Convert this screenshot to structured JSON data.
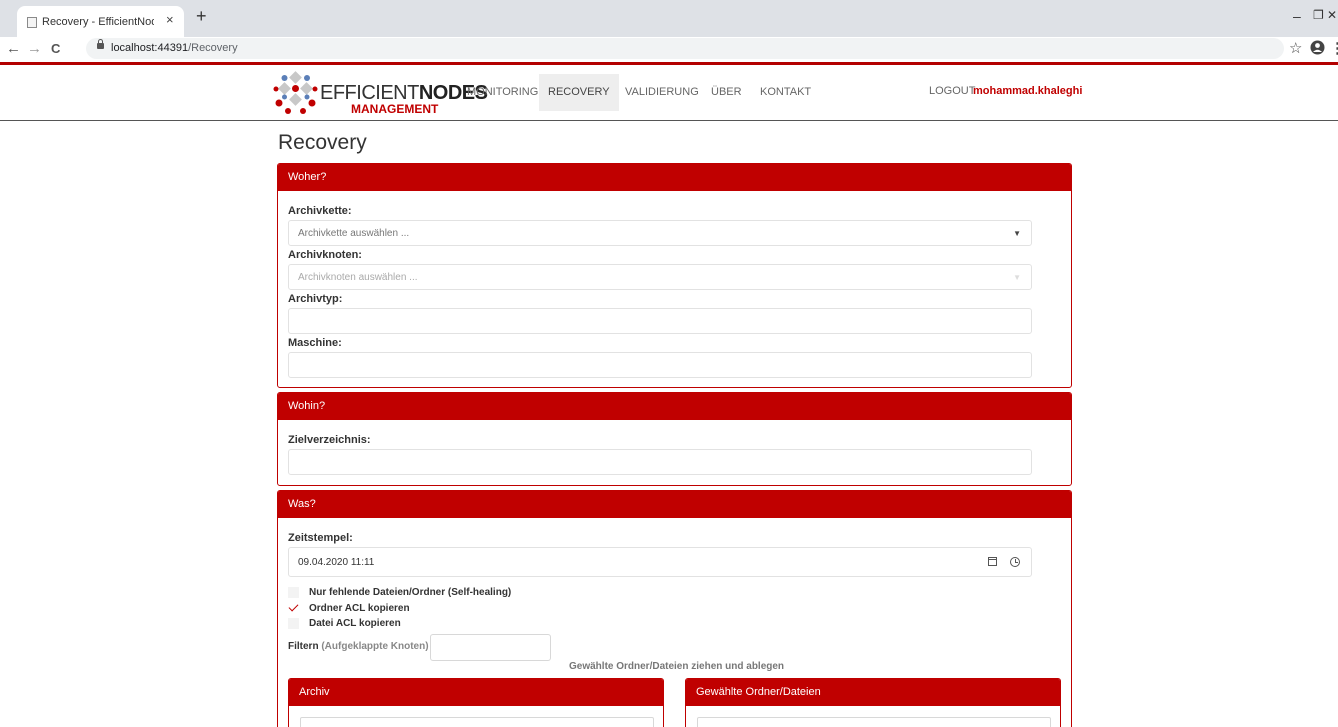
{
  "browser": {
    "tab_title": "Recovery - EfficientNodes.Manag",
    "tab_close": "×",
    "new_tab": "+",
    "url_host": "localhost:44391",
    "url_path": "/Recovery",
    "back": "←",
    "forward": "→",
    "reload": "C",
    "bookmark_star": "☆",
    "menu_dots": "⋮",
    "win_minimize": "–",
    "win_restore": "❐",
    "win_close": "✕"
  },
  "brand": {
    "name_light": "EFFICIENT",
    "name_bold": "NODES",
    "sub": "MANAGEMENT",
    "accent": "#c00000"
  },
  "nav": {
    "items": [
      "MONITORING",
      "RECOVERY",
      "VALIDIERUNG",
      "ÜBER",
      "KONTAKT"
    ],
    "active": "RECOVERY",
    "logout": "LOGOUT",
    "user": "mohammad.khaleghi"
  },
  "page": {
    "title": "Recovery"
  },
  "woher": {
    "heading": "Woher?",
    "archivkette_label": "Archivkette:",
    "archivkette_placeholder": "Archivkette auswählen ...",
    "archivknoten_label": "Archivknoten:",
    "archivknoten_placeholder": "Archivknoten auswählen ...",
    "archivtyp_label": "Archivtyp:",
    "archivtyp_value": "",
    "maschine_label": "Maschine:",
    "maschine_value": ""
  },
  "wohin": {
    "heading": "Wohin?",
    "zielverzeichnis_label": "Zielverzeichnis:",
    "zielverzeichnis_value": ""
  },
  "was": {
    "heading": "Was?",
    "zeitstempel_label": "Zeitstempel:",
    "zeitstempel_value": "09.04.2020 11:11",
    "options": [
      {
        "label": "Nur fehlende Dateien/Ordner (Self-healing)",
        "checked": false
      },
      {
        "label": "Ordner ACL kopieren",
        "checked": true
      },
      {
        "label": "Datei ACL kopieren",
        "checked": false
      }
    ],
    "filter_label": "Filtern",
    "filter_hint": "(Aufgeklappte Knoten)",
    "filter_value": "",
    "dnd_hint": "Gewählte Ordner/Dateien ziehen und ablegen",
    "archiv_heading": "Archiv",
    "selected_heading": "Gewählte Ordner/Dateien"
  }
}
